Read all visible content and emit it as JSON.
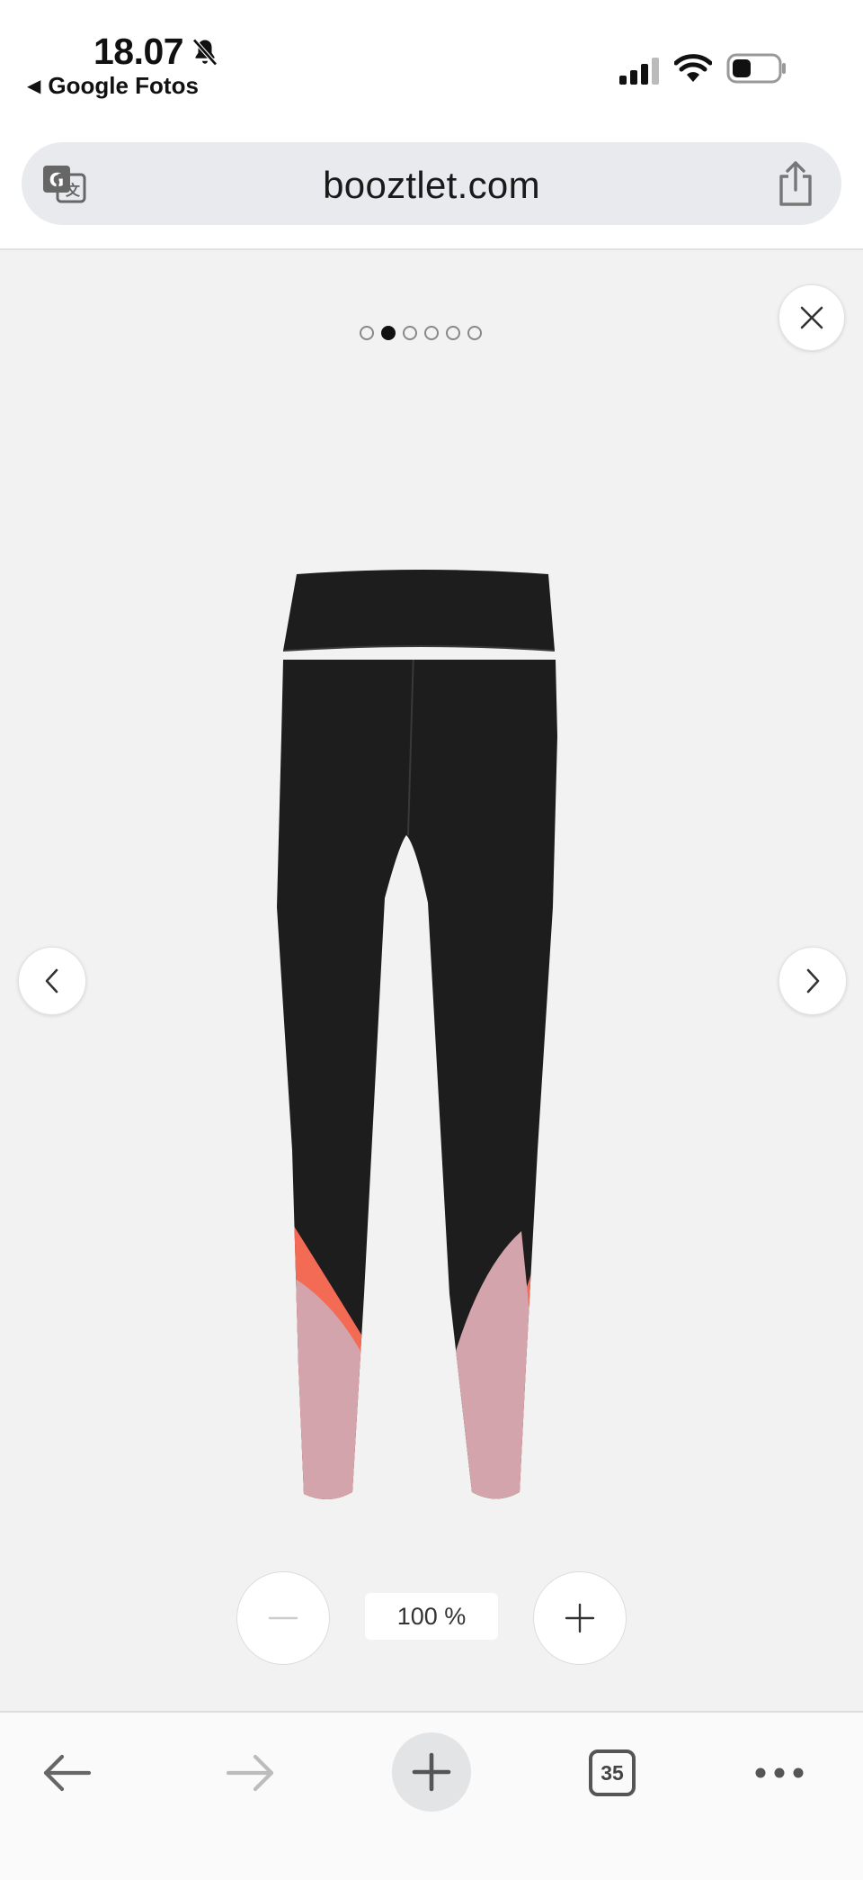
{
  "status_bar": {
    "time": "18.07",
    "back_app_label": "Google Fotos",
    "icons": [
      "bell-slash-icon",
      "signal-icon",
      "wifi-icon",
      "battery-icon"
    ]
  },
  "url_bar": {
    "url": "booztlet.com",
    "left_icon": "translate-icon",
    "right_icon": "share-icon"
  },
  "viewer": {
    "image_count": 6,
    "active_image_index": 1,
    "zoom_level": "100 %",
    "product_colors": {
      "black": "#1e1d1d",
      "coral": "#f46b55",
      "pink": "#d3a4ab"
    }
  },
  "toolbar": {
    "tab_count": "35",
    "buttons": [
      "back-arrow-icon",
      "forward-arrow-icon",
      "plus-icon",
      "tabs-icon",
      "more-icon"
    ]
  }
}
